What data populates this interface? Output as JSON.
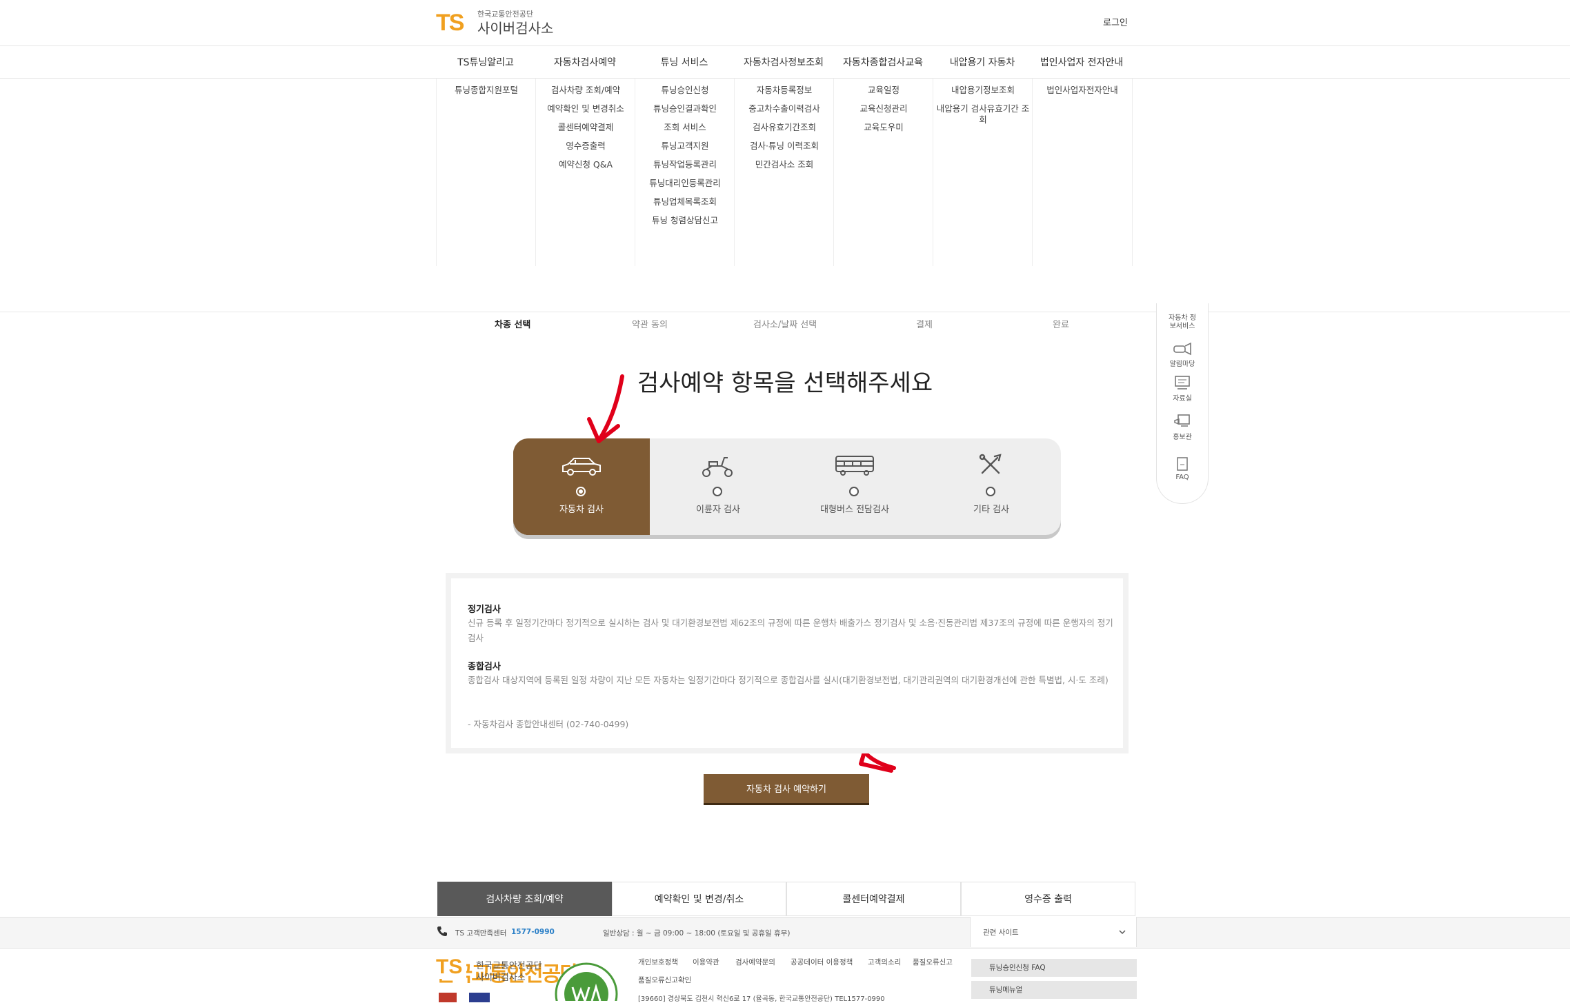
{
  "header": {
    "logo_mark": "TS",
    "logo_org": "한국교통안전공단",
    "logo_site": "사이버검사소",
    "login": "로그인"
  },
  "menu": [
    {
      "label": "TS튜닝알리고",
      "items": [
        "튜닝종합지원포털"
      ]
    },
    {
      "label": "자동차검사예약",
      "items": [
        "검사차량 조회/예약",
        "예약확인 및 변경취소",
        "콜센터예약결제",
        "영수증출력",
        "예약신청 Q&A"
      ]
    },
    {
      "label": "튜닝 서비스",
      "items": [
        "튜닝승인신청",
        "튜닝승인결과확인",
        "조회 서비스",
        "튜닝고객지원",
        "튜닝작업등록관리",
        "튜닝대리인등록관리",
        "튜닝업체목록조회",
        "튜닝 청렴상담신고"
      ]
    },
    {
      "label": "자동차검사정보조회",
      "items": [
        "자동차등록정보",
        "중고차수출이력검사",
        "검사유효기간조회",
        "검사·튜닝 이력조회",
        "민간검사소 조회"
      ]
    },
    {
      "label": "자동차종합검사교육",
      "items": [
        "교육일정",
        "교육신청관리",
        "교육도우미"
      ]
    },
    {
      "label": "내압용기 자동차",
      "items": [
        "내압용기정보조회",
        "내압용기 검사유효기간 조회"
      ]
    },
    {
      "label": "법인사업자 전자안내",
      "items": [
        "법인사업자전자안내"
      ]
    }
  ],
  "steps": [
    "차종 선택",
    "약관 동의",
    "검사소/날짜 선택",
    "결제",
    "완료"
  ],
  "quick_menu": [
    {
      "label": "자동차 정보서비스",
      "icon": "car-info-icon"
    },
    {
      "label": "알림마당",
      "icon": "megaphone-icon"
    },
    {
      "label": "자료실",
      "icon": "board-icon"
    },
    {
      "label": "홍보관",
      "icon": "pr-icon"
    },
    {
      "label": "FAQ",
      "icon": "faq-icon"
    }
  ],
  "main_title": "검사예약 항목을 선택해주세요",
  "options": [
    {
      "label": "자동차 검사",
      "icon": "car-icon",
      "selected": true
    },
    {
      "label": "이륜자 검사",
      "icon": "scooter-icon",
      "selected": false
    },
    {
      "label": "대형버스 전담검사",
      "icon": "bus-icon",
      "selected": false
    },
    {
      "label": "기타 검사",
      "icon": "tools-icon",
      "selected": false
    }
  ],
  "info": {
    "h1": "정기검사",
    "p1": "신규 등록 후 일정기간마다 정기적으로 실시하는 검사 및 대기환경보전법 제62조의 규정에 따른 운행차 배출가스 정기검사 및 소음·진동관리법 제37조의 규정에 따른 운행자의 정기검사",
    "h2": "종합검사",
    "p2": "종합검사 대상지역에 등록된 일정 차량이 지난 모든 자동차는 일정기간마다 정기적으로 종합검사를 실시(대기환경보전법, 대기관리권역의 대기환경개선에 관한 특별법, 시·도 조례)",
    "contact": "- 자동차검사 종합안내센터 (02-740-0499)"
  },
  "reserve_button": "자동차 검사 예약하기",
  "bottom_tabs": [
    "검사차량 조회/예약",
    "예약확인 및 변경/취소",
    "콜센터예약결제",
    "영수증 출력"
  ],
  "footer": {
    "callcenter_label": "TS 고객만족센터",
    "callcenter_number": "1577-0990",
    "hours": "일반상담 : 월 ~ 금 09:00 ~ 18:00 (토요일 및 공휴일 휴무)",
    "related_sites": "관련 사이트",
    "org": "한국교통안전공단",
    "site": "사이버검사소",
    "links": [
      "개인보호정책",
      "이용약관",
      "검사예약문의",
      "공공데이터 이용정책",
      "고객의소리",
      "품질오류신고",
      "품질오류신고확인"
    ],
    "address": "[39660] 경상북도 김천시 혁신6로 17 (율곡동, 한국교통안전공단) TEL1577-0990",
    "faq_links": [
      "튜닝승인신청 FAQ",
      "튜닝메뉴얼"
    ]
  },
  "colors": {
    "accent": "#7f5b34",
    "logo_orange": "#f0a020",
    "logo_blue": "#2a7fc7",
    "arrow_red": "#e0001a"
  }
}
